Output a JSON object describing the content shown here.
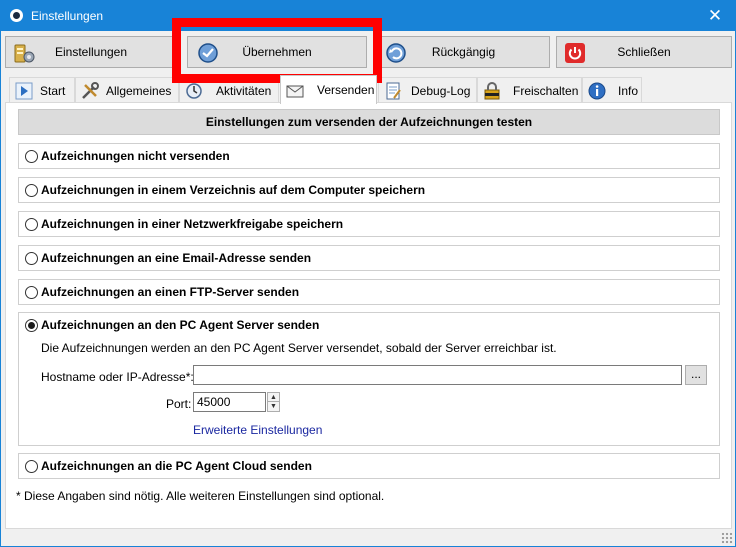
{
  "window": {
    "title": "Einstellungen",
    "close_glyph": "✕"
  },
  "toolbar": {
    "settings_label": "Einstellungen",
    "apply_label": "Übernehmen",
    "undo_label": "Rückgängig",
    "close_label": "Schließen"
  },
  "tabs": [
    {
      "label": "Start",
      "icon": "play-icon"
    },
    {
      "label": "Allgemeines",
      "icon": "tools-icon"
    },
    {
      "label": "Aktivitäten",
      "icon": "clock-icon"
    },
    {
      "label": "Versenden",
      "icon": "mail-icon",
      "active": true
    },
    {
      "label": "Debug-Log",
      "icon": "notepad-icon"
    },
    {
      "label": "Freischalten",
      "icon": "lock-icon"
    },
    {
      "label": "Info",
      "icon": "info-icon"
    }
  ],
  "panel": {
    "test_header": "Einstellungen zum versenden der Aufzeichnungen testen",
    "options": [
      "Aufzeichnungen nicht versenden",
      "Aufzeichnungen in einem Verzeichnis auf dem Computer speichern",
      "Aufzeichnungen in einer Netzwerkfreigabe speichern",
      "Aufzeichnungen an eine Email-Adresse senden",
      "Aufzeichnungen an einen FTP-Server senden",
      "Aufzeichnungen an den PC Agent Server senden",
      "Aufzeichnungen an die PC Agent Cloud senden"
    ],
    "selected_option": 5,
    "server": {
      "description": "Die Aufzeichnungen werden an den PC Agent Server versendet, sobald der Server erreichbar ist.",
      "host_label": "Hostname oder IP-Adresse*:",
      "host_value": "",
      "browse_label": "...",
      "port_label": "Port:",
      "port_value": "45000",
      "advanced_link": "Erweiterte Einstellungen"
    },
    "footnote": "* Diese Angaben sind nötig. Alle weiteren Einstellungen sind optional."
  },
  "colors": {
    "titlebar": "#1883d7",
    "highlight": "#ff0000",
    "link": "#1a27a0",
    "close_button_red": "#e02b2b"
  }
}
